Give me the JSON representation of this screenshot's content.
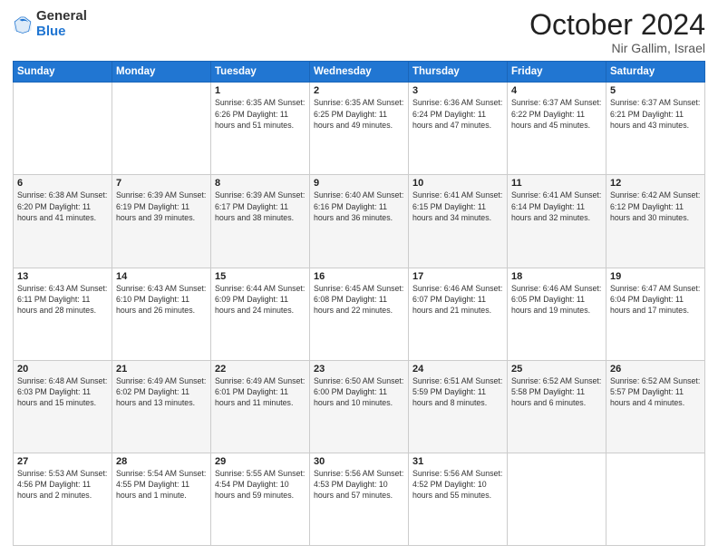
{
  "logo": {
    "general": "General",
    "blue": "Blue"
  },
  "header": {
    "month": "October 2024",
    "location": "Nir Gallim, Israel"
  },
  "weekdays": [
    "Sunday",
    "Monday",
    "Tuesday",
    "Wednesday",
    "Thursday",
    "Friday",
    "Saturday"
  ],
  "weeks": [
    [
      {
        "day": "",
        "info": ""
      },
      {
        "day": "",
        "info": ""
      },
      {
        "day": "1",
        "info": "Sunrise: 6:35 AM\nSunset: 6:26 PM\nDaylight: 11 hours and 51 minutes."
      },
      {
        "day": "2",
        "info": "Sunrise: 6:35 AM\nSunset: 6:25 PM\nDaylight: 11 hours and 49 minutes."
      },
      {
        "day": "3",
        "info": "Sunrise: 6:36 AM\nSunset: 6:24 PM\nDaylight: 11 hours and 47 minutes."
      },
      {
        "day": "4",
        "info": "Sunrise: 6:37 AM\nSunset: 6:22 PM\nDaylight: 11 hours and 45 minutes."
      },
      {
        "day": "5",
        "info": "Sunrise: 6:37 AM\nSunset: 6:21 PM\nDaylight: 11 hours and 43 minutes."
      }
    ],
    [
      {
        "day": "6",
        "info": "Sunrise: 6:38 AM\nSunset: 6:20 PM\nDaylight: 11 hours and 41 minutes."
      },
      {
        "day": "7",
        "info": "Sunrise: 6:39 AM\nSunset: 6:19 PM\nDaylight: 11 hours and 39 minutes."
      },
      {
        "day": "8",
        "info": "Sunrise: 6:39 AM\nSunset: 6:17 PM\nDaylight: 11 hours and 38 minutes."
      },
      {
        "day": "9",
        "info": "Sunrise: 6:40 AM\nSunset: 6:16 PM\nDaylight: 11 hours and 36 minutes."
      },
      {
        "day": "10",
        "info": "Sunrise: 6:41 AM\nSunset: 6:15 PM\nDaylight: 11 hours and 34 minutes."
      },
      {
        "day": "11",
        "info": "Sunrise: 6:41 AM\nSunset: 6:14 PM\nDaylight: 11 hours and 32 minutes."
      },
      {
        "day": "12",
        "info": "Sunrise: 6:42 AM\nSunset: 6:12 PM\nDaylight: 11 hours and 30 minutes."
      }
    ],
    [
      {
        "day": "13",
        "info": "Sunrise: 6:43 AM\nSunset: 6:11 PM\nDaylight: 11 hours and 28 minutes."
      },
      {
        "day": "14",
        "info": "Sunrise: 6:43 AM\nSunset: 6:10 PM\nDaylight: 11 hours and 26 minutes."
      },
      {
        "day": "15",
        "info": "Sunrise: 6:44 AM\nSunset: 6:09 PM\nDaylight: 11 hours and 24 minutes."
      },
      {
        "day": "16",
        "info": "Sunrise: 6:45 AM\nSunset: 6:08 PM\nDaylight: 11 hours and 22 minutes."
      },
      {
        "day": "17",
        "info": "Sunrise: 6:46 AM\nSunset: 6:07 PM\nDaylight: 11 hours and 21 minutes."
      },
      {
        "day": "18",
        "info": "Sunrise: 6:46 AM\nSunset: 6:05 PM\nDaylight: 11 hours and 19 minutes."
      },
      {
        "day": "19",
        "info": "Sunrise: 6:47 AM\nSunset: 6:04 PM\nDaylight: 11 hours and 17 minutes."
      }
    ],
    [
      {
        "day": "20",
        "info": "Sunrise: 6:48 AM\nSunset: 6:03 PM\nDaylight: 11 hours and 15 minutes."
      },
      {
        "day": "21",
        "info": "Sunrise: 6:49 AM\nSunset: 6:02 PM\nDaylight: 11 hours and 13 minutes."
      },
      {
        "day": "22",
        "info": "Sunrise: 6:49 AM\nSunset: 6:01 PM\nDaylight: 11 hours and 11 minutes."
      },
      {
        "day": "23",
        "info": "Sunrise: 6:50 AM\nSunset: 6:00 PM\nDaylight: 11 hours and 10 minutes."
      },
      {
        "day": "24",
        "info": "Sunrise: 6:51 AM\nSunset: 5:59 PM\nDaylight: 11 hours and 8 minutes."
      },
      {
        "day": "25",
        "info": "Sunrise: 6:52 AM\nSunset: 5:58 PM\nDaylight: 11 hours and 6 minutes."
      },
      {
        "day": "26",
        "info": "Sunrise: 6:52 AM\nSunset: 5:57 PM\nDaylight: 11 hours and 4 minutes."
      }
    ],
    [
      {
        "day": "27",
        "info": "Sunrise: 5:53 AM\nSunset: 4:56 PM\nDaylight: 11 hours and 2 minutes."
      },
      {
        "day": "28",
        "info": "Sunrise: 5:54 AM\nSunset: 4:55 PM\nDaylight: 11 hours and 1 minute."
      },
      {
        "day": "29",
        "info": "Sunrise: 5:55 AM\nSunset: 4:54 PM\nDaylight: 10 hours and 59 minutes."
      },
      {
        "day": "30",
        "info": "Sunrise: 5:56 AM\nSunset: 4:53 PM\nDaylight: 10 hours and 57 minutes."
      },
      {
        "day": "31",
        "info": "Sunrise: 5:56 AM\nSunset: 4:52 PM\nDaylight: 10 hours and 55 minutes."
      },
      {
        "day": "",
        "info": ""
      },
      {
        "day": "",
        "info": ""
      }
    ]
  ]
}
